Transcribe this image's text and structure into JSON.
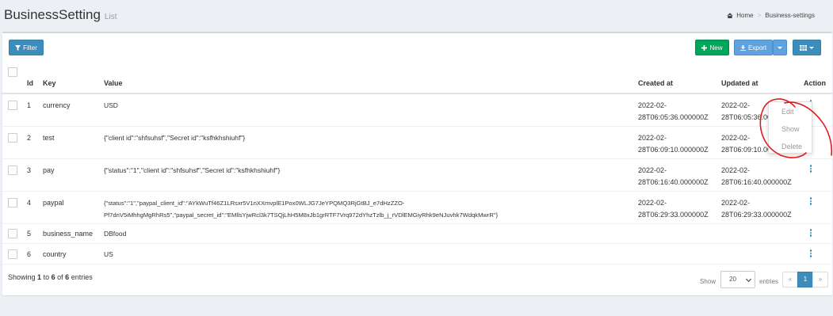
{
  "header": {
    "title": "BusinessSetting",
    "subtitle": "List",
    "breadcrumb": [
      "Home",
      "Business-settings"
    ]
  },
  "toolbar": {
    "filter_label": "Filter",
    "new_label": "New",
    "export_label": "Export"
  },
  "table": {
    "columns": [
      "Id",
      "Key",
      "Value",
      "Created at",
      "Updated at",
      "Action"
    ],
    "rows": [
      {
        "id": "1",
        "key": "currency",
        "value": [
          "USD"
        ],
        "created": [
          "2022-02-",
          "28T06:05:36.000000Z"
        ],
        "updated": [
          "2022-02-",
          "28T06:05:36.000000Z"
        ]
      },
      {
        "id": "2",
        "key": "test",
        "value": [
          "{\"client id\":\"shfsuhsf\",\"Secret id\":\"ksfhkhshiuhf\"}"
        ],
        "created": [
          "2022-02-",
          "28T06:09:10.000000Z"
        ],
        "updated": [
          "2022-02-",
          "28T06:09:10.000000Z"
        ]
      },
      {
        "id": "3",
        "key": "pay",
        "value": [
          "{\"status\":\"1\",\"client id\":\"shfsuhsf\",\"Secret id\":\"ksfhkhshiuhf\"}"
        ],
        "created": [
          "2022-02-",
          "28T06:16:40.000000Z"
        ],
        "updated": [
          "2022-02-",
          "28T06:16:40.000000Z"
        ]
      },
      {
        "id": "4",
        "key": "paypal",
        "value": [
          "{\"status\":\"1\",\"paypal_client_id\":\"AYkWuTf46Z1LRsxr5V1nXXmvplE1Pox0WLJG7JeYPQMQ3RjGtBJ_e7dHzZZO-",
          "Pf7dnV5iMhhgMgRhRs5\",\"paypal_secret_id\":\"EMllsYjwRcl3k7TSQjLhH5M8xJb1grRTF7Vrq972dYhzTzlb_j_rVDlEMGiyRhk9eNJuvhk7WdqkMwrR\"}"
        ],
        "created": [
          "2022-02-",
          "28T06:29:33.000000Z"
        ],
        "updated": [
          "2022-02-",
          "28T06:29:33.000000Z"
        ]
      },
      {
        "id": "5",
        "key": "business_name",
        "value": [
          "DBfood"
        ],
        "created": [
          "",
          ""
        ],
        "updated": [
          "",
          ""
        ]
      },
      {
        "id": "6",
        "key": "country",
        "value": [
          "US"
        ],
        "created": [
          "",
          ""
        ],
        "updated": [
          "",
          ""
        ]
      }
    ]
  },
  "row_menu": {
    "items": [
      "Edit",
      "Show",
      "Delete"
    ]
  },
  "footer": {
    "showing_prefix": "Showing",
    "showing_from": "1",
    "showing_to_word": "to",
    "showing_to": "6",
    "showing_of_word": "of",
    "showing_total": "6",
    "showing_suffix": "entries",
    "show_label": "Show",
    "per_page": "20",
    "entries_label": "entries",
    "prev": "«",
    "current_page": "1",
    "next": "»"
  },
  "colors": {
    "primary": "#3c8dbc",
    "success": "#00a65a",
    "annotation": "#e01b1b"
  },
  "icons": [
    "home-icon",
    "filter-icon",
    "plus-icon",
    "download-icon",
    "columns-icon",
    "kebab-menu-icon"
  ]
}
